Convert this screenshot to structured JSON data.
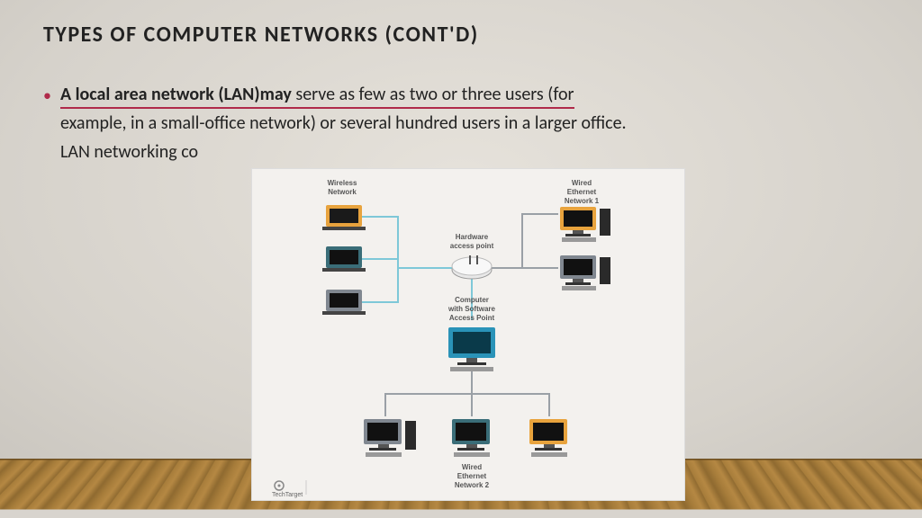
{
  "title": "TYPES OF COMPUTER NETWORKS  (CONT'D)",
  "bullet": {
    "bold": "A local area network (LAN)may",
    "line1_rest": " serve as few as two or three users (for",
    "line2": "example, in a small-office network) or several hundred users in a larger office.",
    "line3": "LAN networking co"
  },
  "diagram": {
    "labels": {
      "wireless": "Wireless\nNetwork",
      "wired1": "Wired\nEthernet\nNetwork 1",
      "hap": "Hardware\naccess point",
      "sap": "Computer\nwith Software\nAccess Point",
      "wired2": "Wired\nEthernet\nNetwork 2",
      "logo": "TechTarget"
    }
  }
}
